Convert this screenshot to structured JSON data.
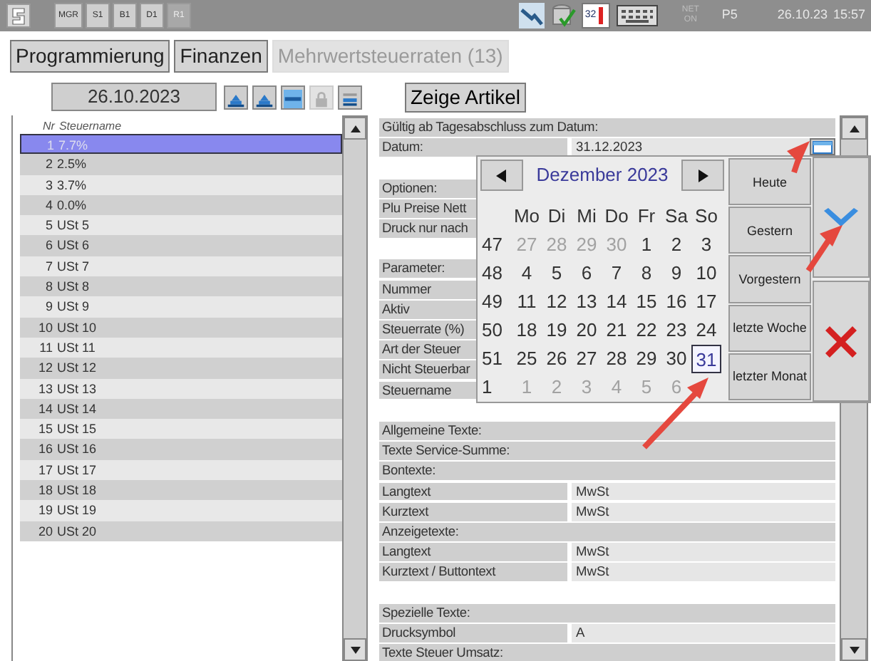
{
  "status_bar": {
    "buttons": [
      {
        "label": "MGR",
        "disabled": false
      },
      {
        "label": "S1",
        "disabled": false
      },
      {
        "label": "B1",
        "disabled": false
      },
      {
        "label": "D1",
        "disabled": false
      },
      {
        "label": "R1",
        "disabled": true
      }
    ],
    "badge": "32",
    "net": "NET",
    "net_state": "ON",
    "printer": "P5",
    "date": "26.10.23",
    "time": "15:57"
  },
  "tabs": [
    {
      "label": "Programmierung",
      "disabled": false
    },
    {
      "label": "Finanzen",
      "disabled": false
    },
    {
      "label": "Mehrwertsteuerraten (13)",
      "disabled": true
    }
  ],
  "toolbar": {
    "date": "26.10.2023",
    "tools": [
      {
        "kind": "stack",
        "disabled": false
      },
      {
        "kind": "stack",
        "disabled": false
      },
      {
        "kind": "dash",
        "disabled": false
      },
      {
        "kind": "lock",
        "disabled": true
      },
      {
        "kind": "lines",
        "disabled": false
      }
    ],
    "show_button": "Zeige Artikel"
  },
  "list": {
    "columns": [
      "Nr",
      "Steuername"
    ],
    "rows": [
      {
        "nr": "1",
        "name": "7.7%",
        "selected": true
      },
      {
        "nr": "2",
        "name": "2.5%",
        "selected": false
      },
      {
        "nr": "3",
        "name": "3.7%",
        "selected": false
      },
      {
        "nr": "4",
        "name": "0.0%",
        "selected": false
      },
      {
        "nr": "5",
        "name": "USt 5",
        "selected": false
      },
      {
        "nr": "6",
        "name": "USt 6",
        "selected": false
      },
      {
        "nr": "7",
        "name": "USt 7",
        "selected": false
      },
      {
        "nr": "8",
        "name": "USt 8",
        "selected": false
      },
      {
        "nr": "9",
        "name": "USt 9",
        "selected": false
      },
      {
        "nr": "10",
        "name": "USt 10",
        "selected": false
      },
      {
        "nr": "11",
        "name": "USt 11",
        "selected": false
      },
      {
        "nr": "12",
        "name": "USt 12",
        "selected": false
      },
      {
        "nr": "13",
        "name": "USt 13",
        "selected": false
      },
      {
        "nr": "14",
        "name": "USt 14",
        "selected": false
      },
      {
        "nr": "15",
        "name": "USt 15",
        "selected": false
      },
      {
        "nr": "16",
        "name": "USt 16",
        "selected": false
      },
      {
        "nr": "17",
        "name": "USt 17",
        "selected": false
      },
      {
        "nr": "18",
        "name": "USt 18",
        "selected": false
      },
      {
        "nr": "19",
        "name": "USt 19",
        "selected": false
      },
      {
        "nr": "20",
        "name": "USt 20",
        "selected": false
      }
    ]
  },
  "detail": {
    "rows": [
      {
        "kind": "section",
        "label": "Gültig ab Tagesabschluss zum Datum:"
      },
      {
        "kind": "date",
        "label": "Datum:",
        "value": "31.12.2023"
      },
      {
        "kind": "gap"
      },
      {
        "kind": "section",
        "label": "Optionen:"
      },
      {
        "kind": "section",
        "label": "Plu Preise Nett"
      },
      {
        "kind": "section",
        "label": "Druck nur nach"
      },
      {
        "kind": "gap"
      },
      {
        "kind": "section",
        "label": "Parameter:"
      },
      {
        "kind": "field",
        "label": "Nummer"
      },
      {
        "kind": "field",
        "label": "Aktiv"
      },
      {
        "kind": "field",
        "label": "Steuerrate (%)"
      },
      {
        "kind": "field",
        "label": "Art der Steuer"
      },
      {
        "kind": "field",
        "label": "Nicht Steuerbar"
      },
      {
        "kind": "field",
        "label": "Steuername"
      },
      {
        "kind": "gap"
      },
      {
        "kind": "section",
        "label": "Allgemeine Texte:"
      },
      {
        "kind": "section",
        "label": "Texte Service-Summe:"
      },
      {
        "kind": "section",
        "label": "Bontexte:"
      },
      {
        "kind": "field",
        "label": "Langtext",
        "value": "MwSt"
      },
      {
        "kind": "field",
        "label": "Kurztext",
        "value": "MwSt"
      },
      {
        "kind": "section",
        "label": "Anzeigetexte:"
      },
      {
        "kind": "field",
        "label": "Langtext",
        "value": "MwSt"
      },
      {
        "kind": "field",
        "label": "Kurztext / Buttontext",
        "value": "MwSt"
      },
      {
        "kind": "gap"
      },
      {
        "kind": "section",
        "label": "Spezielle Texte:"
      },
      {
        "kind": "field",
        "label": "Drucksymbol",
        "value": "A"
      },
      {
        "kind": "section",
        "label": "Texte Steuer Umsatz:"
      }
    ]
  },
  "date_picker": {
    "month": "Dezember 2023",
    "weekdays": [
      "Mo",
      "Di",
      "Mi",
      "Do",
      "Fr",
      "Sa",
      "So"
    ],
    "weeks": [
      {
        "week": "47",
        "days": [
          {
            "day": "27",
            "other_month": true,
            "selected": false
          },
          {
            "day": "28",
            "other_month": true,
            "selected": false
          },
          {
            "day": "29",
            "other_month": true,
            "selected": false
          },
          {
            "day": "30",
            "other_month": true,
            "selected": false
          },
          {
            "day": "1",
            "other_month": false,
            "selected": false
          },
          {
            "day": "2",
            "other_month": false,
            "selected": false
          },
          {
            "day": "3",
            "other_month": false,
            "selected": false
          }
        ]
      },
      {
        "week": "48",
        "days": [
          {
            "day": "4",
            "other_month": false,
            "selected": false
          },
          {
            "day": "5",
            "other_month": false,
            "selected": false
          },
          {
            "day": "6",
            "other_month": false,
            "selected": false
          },
          {
            "day": "7",
            "other_month": false,
            "selected": false
          },
          {
            "day": "8",
            "other_month": false,
            "selected": false
          },
          {
            "day": "9",
            "other_month": false,
            "selected": false
          },
          {
            "day": "10",
            "other_month": false,
            "selected": false
          }
        ]
      },
      {
        "week": "49",
        "days": [
          {
            "day": "11",
            "other_month": false,
            "selected": false
          },
          {
            "day": "12",
            "other_month": false,
            "selected": false
          },
          {
            "day": "13",
            "other_month": false,
            "selected": false
          },
          {
            "day": "14",
            "other_month": false,
            "selected": false
          },
          {
            "day": "15",
            "other_month": false,
            "selected": false
          },
          {
            "day": "16",
            "other_month": false,
            "selected": false
          },
          {
            "day": "17",
            "other_month": false,
            "selected": false
          }
        ]
      },
      {
        "week": "50",
        "days": [
          {
            "day": "18",
            "other_month": false,
            "selected": false
          },
          {
            "day": "19",
            "other_month": false,
            "selected": false
          },
          {
            "day": "20",
            "other_month": false,
            "selected": false
          },
          {
            "day": "21",
            "other_month": false,
            "selected": false
          },
          {
            "day": "22",
            "other_month": false,
            "selected": false
          },
          {
            "day": "23",
            "other_month": false,
            "selected": false
          },
          {
            "day": "24",
            "other_month": false,
            "selected": false
          }
        ]
      },
      {
        "week": "51",
        "days": [
          {
            "day": "25",
            "other_month": false,
            "selected": false
          },
          {
            "day": "26",
            "other_month": false,
            "selected": false
          },
          {
            "day": "27",
            "other_month": false,
            "selected": false
          },
          {
            "day": "28",
            "other_month": false,
            "selected": false
          },
          {
            "day": "29",
            "other_month": false,
            "selected": false
          },
          {
            "day": "30",
            "other_month": false,
            "selected": false
          },
          {
            "day": "31",
            "other_month": false,
            "selected": true
          }
        ]
      },
      {
        "week": "1",
        "days": [
          {
            "day": "1",
            "other_month": true,
            "selected": false
          },
          {
            "day": "2",
            "other_month": true,
            "selected": false
          },
          {
            "day": "3",
            "other_month": true,
            "selected": false
          },
          {
            "day": "4",
            "other_month": true,
            "selected": false
          },
          {
            "day": "5",
            "other_month": true,
            "selected": false
          },
          {
            "day": "6",
            "other_month": true,
            "selected": false
          }
        ]
      }
    ],
    "shortcuts": [
      "Heute",
      "Gestern",
      "Vorgestern",
      "letzte Woche",
      "letzter Monat"
    ]
  }
}
